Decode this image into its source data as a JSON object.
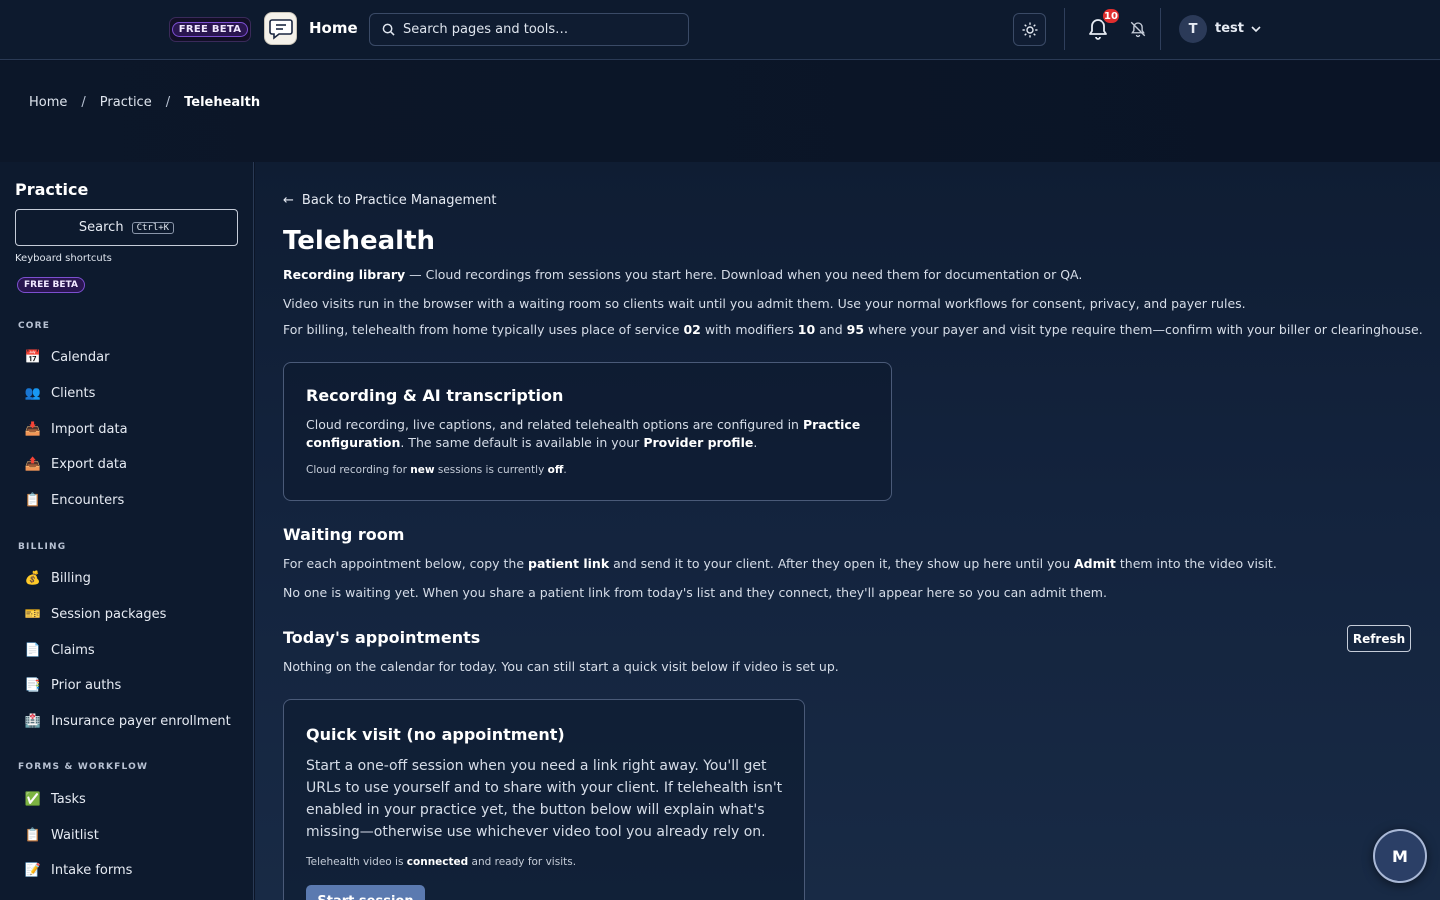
{
  "header": {
    "beta_badge": "FREE BETA",
    "title": "Home",
    "search_placeholder": "Search pages and tools…",
    "notification_count": "10",
    "avatar_initial": "T",
    "username": "test"
  },
  "breadcrumb": {
    "items": [
      "Home",
      "Practice",
      "Telehealth"
    ],
    "separator": "/"
  },
  "sidebar": {
    "title": "Practice",
    "search_label": "Search",
    "search_shortcut": "Ctrl+K",
    "keyboard_shortcuts": "Keyboard shortcuts",
    "beta_badge": "FREE BETA",
    "sections": [
      {
        "label": "CORE",
        "items": [
          {
            "label": "Calendar",
            "icon": "📅"
          },
          {
            "label": "Clients",
            "icon": "👥"
          },
          {
            "label": "Import data",
            "icon": "📥"
          },
          {
            "label": "Export data",
            "icon": "📤"
          },
          {
            "label": "Encounters",
            "icon": "📋"
          }
        ]
      },
      {
        "label": "BILLING",
        "items": [
          {
            "label": "Billing",
            "icon": "💰"
          },
          {
            "label": "Session packages",
            "icon": "🎫"
          },
          {
            "label": "Claims",
            "icon": "📄"
          },
          {
            "label": "Prior auths",
            "icon": "📑"
          },
          {
            "label": "Insurance payer enrollment",
            "icon": "🏥"
          }
        ]
      },
      {
        "label": "FORMS & WORKFLOW",
        "items": [
          {
            "label": "Tasks",
            "icon": "✅"
          },
          {
            "label": "Waitlist",
            "icon": "📋"
          },
          {
            "label": "Intake forms",
            "icon": "📝"
          }
        ]
      }
    ]
  },
  "main": {
    "back_arrow": "←",
    "back_link": "Back to Practice Management",
    "title": "Telehealth",
    "recording_library_label": "Recording library",
    "recording_library_text": " — Cloud recordings from sessions you start here. Download when you need them for documentation or QA.",
    "intro": "Video visits run in the browser with a waiting room so clients wait until you admit them. Use your normal workflows for consent, privacy, and payer rules.",
    "billing_note": {
      "a": "For billing, telehealth from home typically uses place of service ",
      "pos": "02",
      "b": " with modifiers ",
      "mod1": "10",
      "c": " and ",
      "mod2": "95",
      "d": " where your payer and visit type require them—confirm with your biller or clearinghouse."
    },
    "recording_card": {
      "title": "Recording & AI transcription",
      "t1": "Cloud recording, live captions, and related telehealth options are configured in ",
      "link1": "Practice",
      "link1b": "configuration",
      "t2": ". The same default is available in your ",
      "link2": "Provider profile",
      "t3": ".",
      "status_a": "Cloud recording for ",
      "status_new": "new",
      "status_b": " sessions is currently ",
      "status_off": "off",
      "status_c": "."
    },
    "waiting_room": {
      "title": "Waiting room",
      "d1": "For each appointment below, copy the ",
      "patient_link": "patient link",
      "d2": " and send it to your client. After they open it, they show up here until you ",
      "admit": "Admit",
      "d3": " them into the video visit.",
      "empty": "No one is waiting yet. When you share a patient link from today's list and they connect, they'll appear here so you can admit them."
    },
    "appointments": {
      "title": "Today's appointments",
      "refresh": "Refresh",
      "empty": "Nothing on the calendar for today. You can still start a quick visit below if video is set up."
    },
    "quick_visit": {
      "title": "Quick visit (no appointment)",
      "l1": "Start a one-off session when you need a link right away. You'll get",
      "l2": "URLs to use yourself and to share with your client. If telehealth isn't",
      "l3": "enabled in your practice yet, the button below will explain what's",
      "l4": "missing—otherwise use whichever video tool you already rely on.",
      "status_a": "Telehealth video is ",
      "status_connected": "connected",
      "status_b": " and ready for visits.",
      "button": "Start session"
    }
  },
  "assistant_fab": "M",
  "colors": {
    "background": "#0b1527",
    "badge_red": "#e02e2e",
    "beta_purple": "#7c4fd0",
    "primary_button": "#5b7ab0"
  }
}
